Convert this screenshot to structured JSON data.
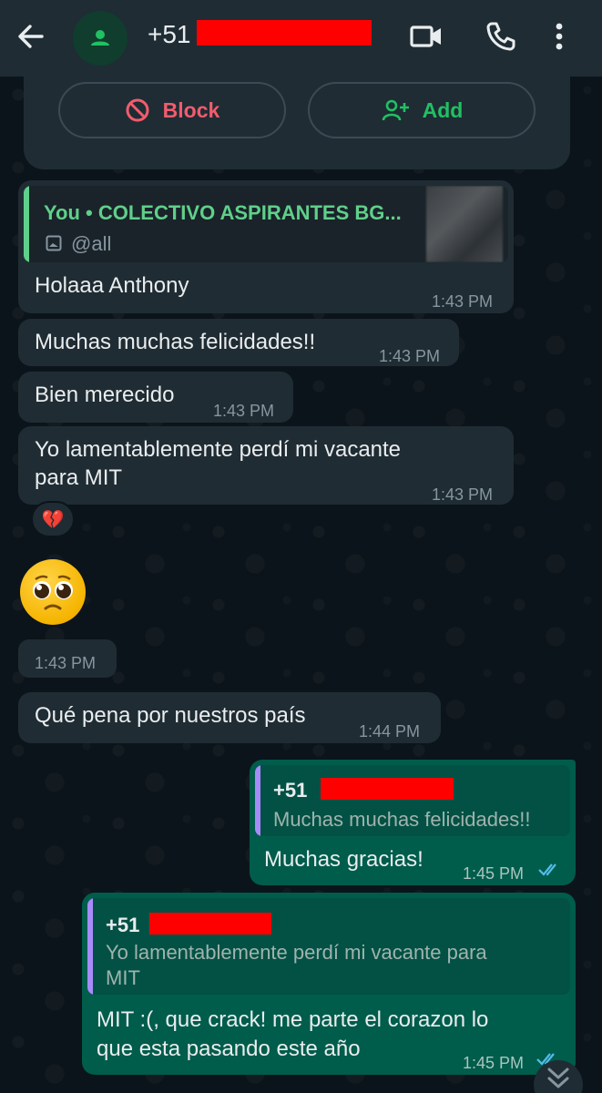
{
  "header": {
    "title": "+51",
    "icons": [
      "back-arrow-icon",
      "person-icon",
      "video-call-icon",
      "phone-icon",
      "more-vert-icon"
    ]
  },
  "actions": {
    "block_label": "Block",
    "add_label": "Add"
  },
  "messages": [
    {
      "direction": "incoming",
      "quote_author": "You • COLECTIVO ASPIRANTES BG...",
      "quote_text": "@all",
      "text": "Holaaa Anthony",
      "time": "1:43 PM"
    },
    {
      "direction": "incoming",
      "text": "Muchas muchas felicidades!!",
      "time": "1:43 PM"
    },
    {
      "direction": "incoming",
      "text": "Bien merecido",
      "time": "1:43 PM"
    },
    {
      "direction": "incoming",
      "text_line1": "Yo lamentablemente perdí mi vacante",
      "text_line2": "para MIT",
      "time": "1:43 PM",
      "reaction": "💔"
    },
    {
      "direction": "incoming",
      "emoji": "pleading-face",
      "time": "1:43 PM"
    },
    {
      "direction": "incoming",
      "text": "Qué pena por nuestros país",
      "time": "1:44 PM"
    },
    {
      "direction": "outgoing",
      "quote_author": "+51",
      "quote_text": "Muchas muchas felicidades!!",
      "text": "Muchas gracias!",
      "time": "1:45 PM"
    },
    {
      "direction": "outgoing",
      "quote_author": "+51",
      "quote_text_line1": "Yo lamentablemente perdí mi vacante para",
      "quote_text_line2": "MIT",
      "text_line1": "MIT :(, que crack! me parte el corazon lo",
      "text_line2": "que esta pasando este año",
      "time": "1:45 PM"
    }
  ],
  "colors": {
    "header_bg": "#1f2c34",
    "incoming_bubble": "#202c33",
    "outgoing_bubble": "#005c4b",
    "block_red": "#f15c6d",
    "add_green": "#21c063",
    "quote_you_green": "#5fd08a",
    "quote_contact_purple": "#a78bfa",
    "read_tick_blue": "#53bdeb",
    "redaction": "#ff0000"
  }
}
